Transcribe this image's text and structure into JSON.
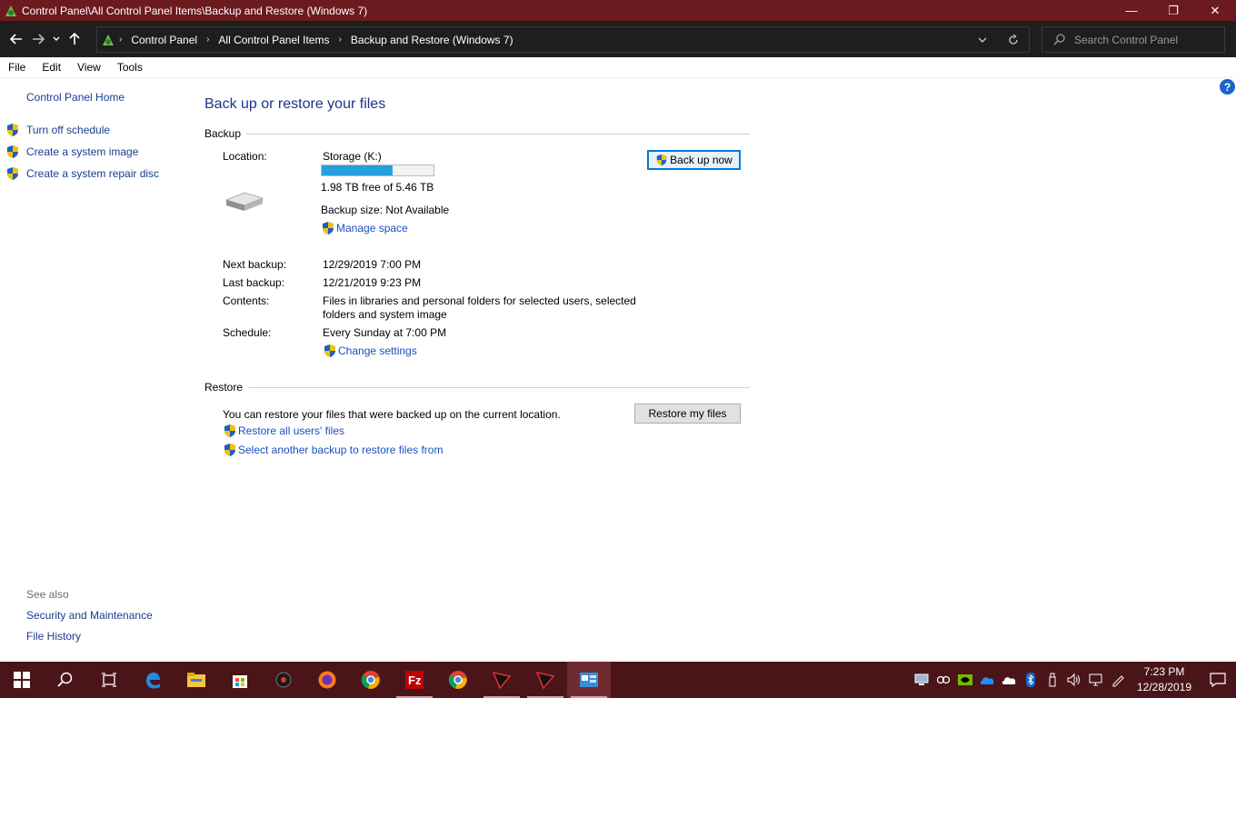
{
  "window": {
    "title": "Control Panel\\All Control Panel Items\\Backup and Restore (Windows 7)",
    "minimize": "—",
    "maximize": "❐",
    "close": "✕"
  },
  "address": {
    "crumbs": [
      "Control Panel",
      "All Control Panel Items",
      "Backup and Restore (Windows 7)"
    ],
    "search_placeholder": "Search Control Panel"
  },
  "menu": [
    "File",
    "Edit",
    "View",
    "Tools"
  ],
  "sidebar": {
    "home": "Control Panel Home",
    "tasks": [
      "Turn off schedule",
      "Create a system image",
      "Create a system repair disc"
    ],
    "see_also_label": "See also",
    "see_also": [
      "Security and Maintenance",
      "File History"
    ]
  },
  "main": {
    "title": "Back up or restore your files",
    "backup": {
      "heading": "Backup",
      "location_label": "Location:",
      "location_value": "Storage (K:)",
      "free_space": "1.98 TB free of 5.46 TB",
      "used_fraction": 0.637,
      "backup_size": "Backup size: Not Available",
      "manage_space": "Manage space",
      "next_label": "Next backup:",
      "next_value": "12/29/2019 7:00 PM",
      "last_label": "Last backup:",
      "last_value": "12/21/2019 9:23 PM",
      "contents_label": "Contents:",
      "contents_line1": "Files in libraries and personal folders for selected users, selected",
      "contents_line2": "folders and system image",
      "schedule_label": "Schedule:",
      "schedule_value": "Every Sunday at 7:00 PM",
      "change_settings": "Change settings",
      "back_up_now": "Back up now"
    },
    "restore": {
      "heading": "Restore",
      "description": "You can restore your files that were backed up on the current location.",
      "restore_my_files": "Restore my files",
      "restore_all": "Restore all users' files",
      "select_another": "Select another backup to restore files from"
    }
  },
  "taskbar": {
    "time": "7:23 PM",
    "date": "12/28/2019",
    "accent": "#4a1518"
  },
  "colors": {
    "title_bar": "#6b1a1f",
    "link": "#1a4fc0",
    "heading": "#1e3287",
    "progress": "#26a0da"
  }
}
